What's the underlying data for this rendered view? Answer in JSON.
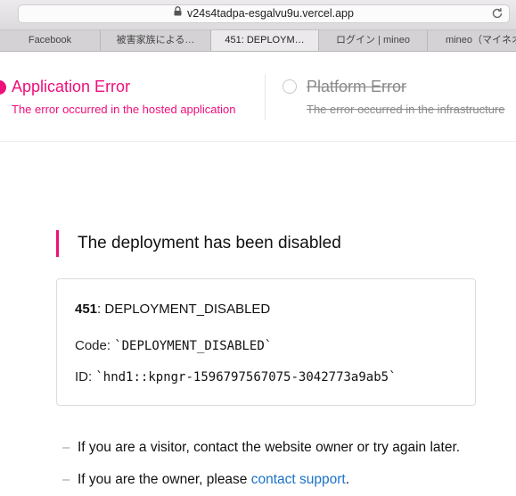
{
  "browser": {
    "url": "v24s4tadpa-esgalvu9u.vercel.app",
    "tabs": [
      {
        "label": "Facebook"
      },
      {
        "label": "被害家族による…"
      },
      {
        "label": "451: DEPLOYM…",
        "active": true
      },
      {
        "label": "ログイン | mineo"
      },
      {
        "label": "mineo（マイネオ）"
      }
    ]
  },
  "error_types": {
    "application": {
      "title": "Application Error",
      "description": "The error occurred in the hosted application"
    },
    "platform": {
      "title": "Platform Error",
      "description": "The error occurred in the infrastructure"
    }
  },
  "main": {
    "heading": "The deployment has been disabled",
    "status_code": "451",
    "status_name": ": DEPLOYMENT_DISABLED",
    "code_label": "Code:",
    "code_value": "`DEPLOYMENT_DISABLED`",
    "id_label": "ID:",
    "id_value": "`hnd1::kpngr-1596797567075-3042773a9ab5`",
    "bullet_mark": "–",
    "visitor_text": "If you are a visitor, contact the website owner or try again later.",
    "owner_text": "If you are the owner, please ",
    "owner_link": "contact support",
    "owner_end": "."
  },
  "colors": {
    "accent": "#ef0f7a",
    "link": "#1a73c8",
    "muted": "#8a8a8a"
  }
}
